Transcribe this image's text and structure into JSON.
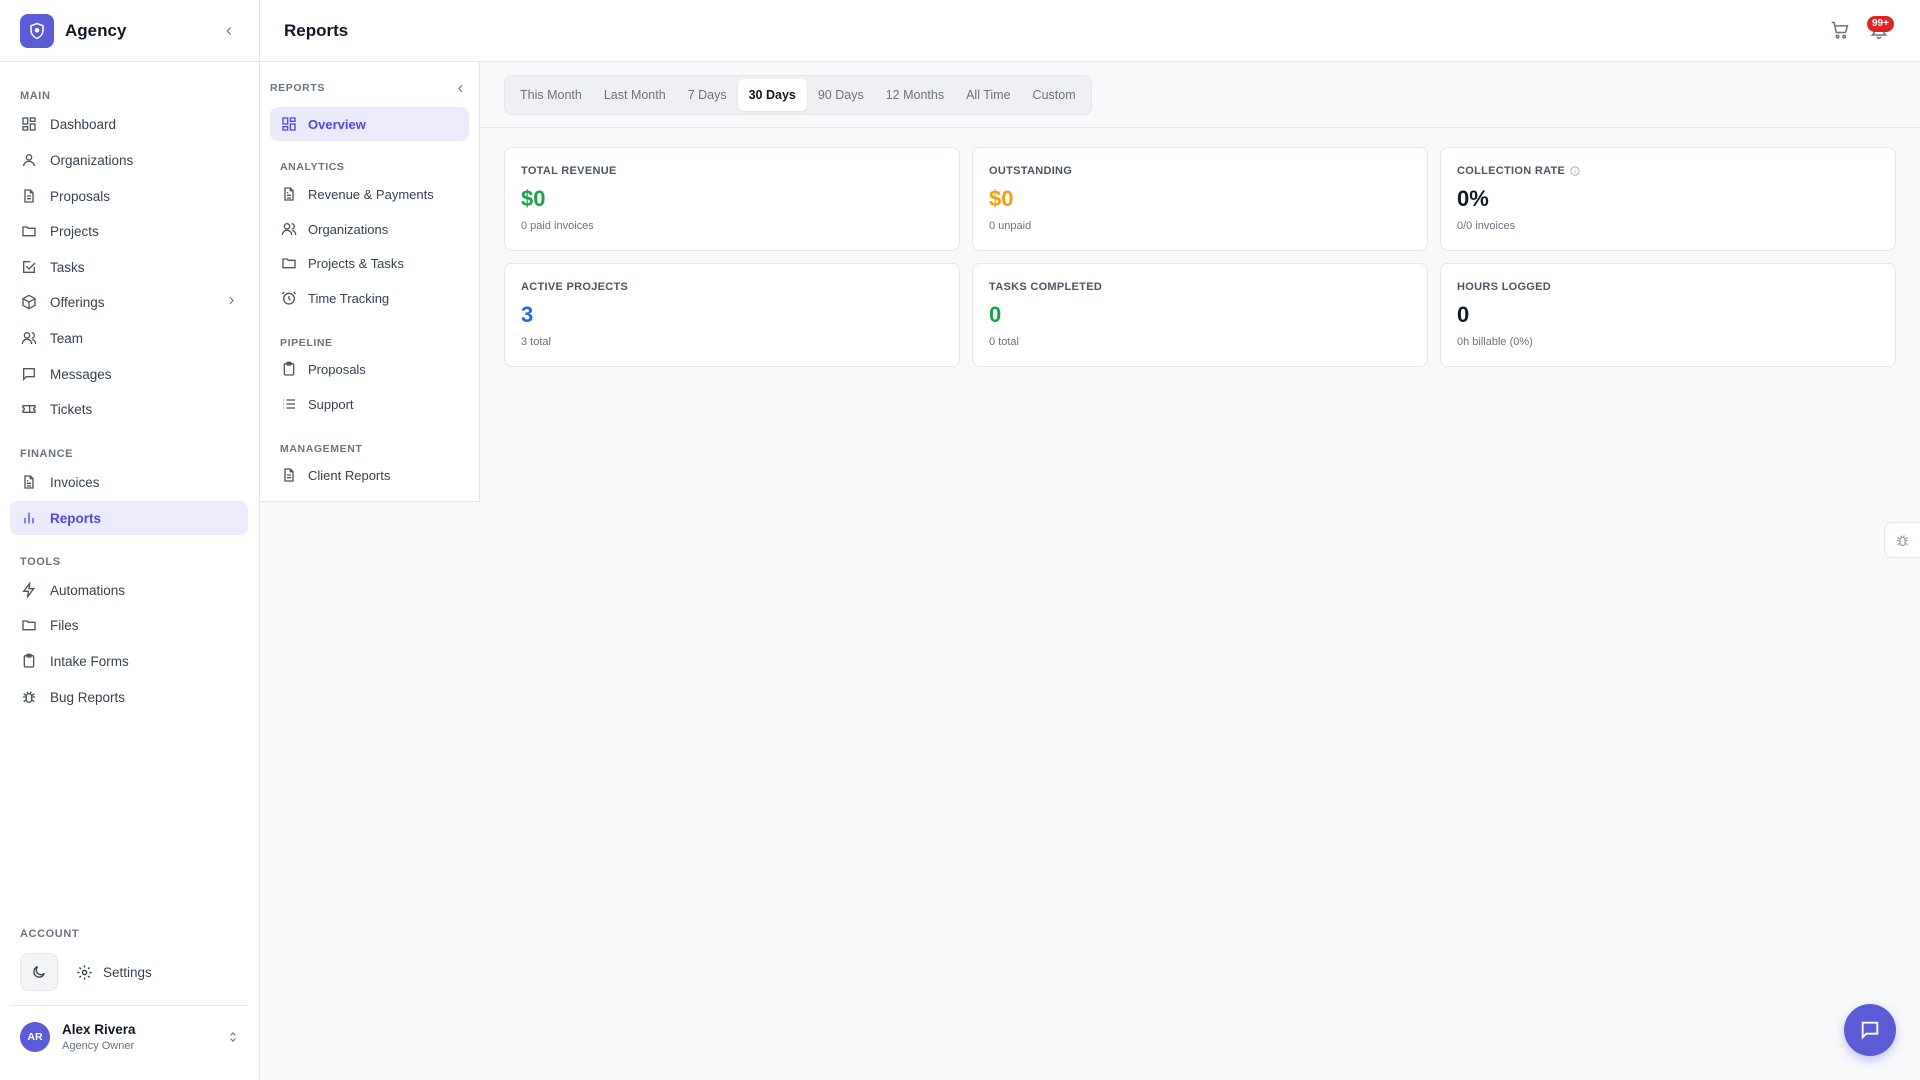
{
  "brand": {
    "name": "Agency"
  },
  "sidebar": {
    "sections": {
      "main": "MAIN",
      "finance": "FINANCE",
      "tools": "TOOLS",
      "account": "ACCOUNT"
    },
    "main_items": [
      {
        "label": "Dashboard",
        "icon": "grid-icon"
      },
      {
        "label": "Organizations",
        "icon": "user-icon"
      },
      {
        "label": "Proposals",
        "icon": "document-icon"
      },
      {
        "label": "Projects",
        "icon": "folder-icon"
      },
      {
        "label": "Tasks",
        "icon": "check-square-icon"
      },
      {
        "label": "Offerings",
        "icon": "box-icon"
      },
      {
        "label": "Team",
        "icon": "users-icon"
      },
      {
        "label": "Messages",
        "icon": "message-icon"
      },
      {
        "label": "Tickets",
        "icon": "ticket-icon"
      }
    ],
    "finance_items": [
      {
        "label": "Invoices",
        "icon": "invoice-icon"
      },
      {
        "label": "Reports",
        "icon": "bar-chart-icon"
      }
    ],
    "tools_items": [
      {
        "label": "Automations",
        "icon": "bolt-icon"
      },
      {
        "label": "Files",
        "icon": "folder-icon"
      },
      {
        "label": "Intake Forms",
        "icon": "clipboard-icon"
      },
      {
        "label": "Bug Reports",
        "icon": "bug-icon"
      }
    ],
    "settings_label": "Settings"
  },
  "user": {
    "initials": "AR",
    "name": "Alex Rivera",
    "role": "Agency Owner"
  },
  "header": {
    "title": "Reports",
    "notification_count": "99+"
  },
  "subnav": {
    "title": "REPORTS",
    "overview": "Overview",
    "sections": {
      "analytics": "ANALYTICS",
      "pipeline": "PIPELINE",
      "management": "MANAGEMENT"
    },
    "analytics_items": [
      "Revenue & Payments",
      "Organizations",
      "Projects & Tasks",
      "Time Tracking"
    ],
    "pipeline_items": [
      "Proposals",
      "Support"
    ],
    "management_items": [
      "Client Reports"
    ]
  },
  "period_tabs": [
    "This Month",
    "Last Month",
    "7 Days",
    "30 Days",
    "90 Days",
    "12 Months",
    "All Time",
    "Custom"
  ],
  "active_period": "30 Days",
  "cards": [
    {
      "label": "TOTAL REVENUE",
      "value": "$0",
      "sub": "0 paid invoices",
      "color": "#16a34a"
    },
    {
      "label": "OUTSTANDING",
      "value": "$0",
      "sub": "0 unpaid",
      "color": "#f59e0b"
    },
    {
      "label": "COLLECTION RATE",
      "value": "0%",
      "sub": "0/0 invoices",
      "color": "#111827"
    },
    {
      "label": "ACTIVE PROJECTS",
      "value": "3",
      "sub": "3 total",
      "color": "#2563eb"
    },
    {
      "label": "TASKS COMPLETED",
      "value": "0",
      "sub": "0 total",
      "color": "#16a34a"
    },
    {
      "label": "HOURS LOGGED",
      "value": "0",
      "sub": "0h billable (0%)",
      "color": "#111827"
    }
  ],
  "colors": {
    "accent": "#5b5bd6",
    "badge": "#dc2626"
  }
}
